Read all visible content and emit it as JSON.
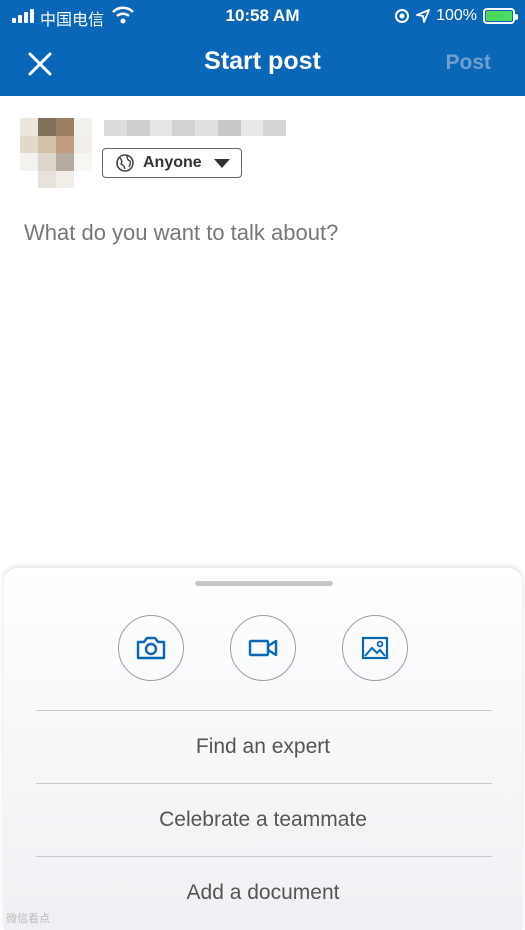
{
  "status_bar": {
    "carrier": "中国电信",
    "time": "10:58 AM",
    "battery": "100%"
  },
  "header": {
    "title": "Start post",
    "post_label": "Post",
    "close_icon": "close-icon"
  },
  "author": {
    "audience_label": "Anyone",
    "audience_icon": "globe-icon"
  },
  "composer": {
    "placeholder": "What do you want to talk about?"
  },
  "bottom_sheet": {
    "media_buttons": [
      "camera-icon",
      "video-icon",
      "photo-icon"
    ],
    "actions": [
      "Find an expert",
      "Celebrate a teammate",
      "Add a document"
    ]
  },
  "watermark": "微信看点",
  "colors": {
    "brand": "#0a66b7",
    "post_disabled": "#6fa0cf",
    "icon_blue": "#0a66b7"
  }
}
